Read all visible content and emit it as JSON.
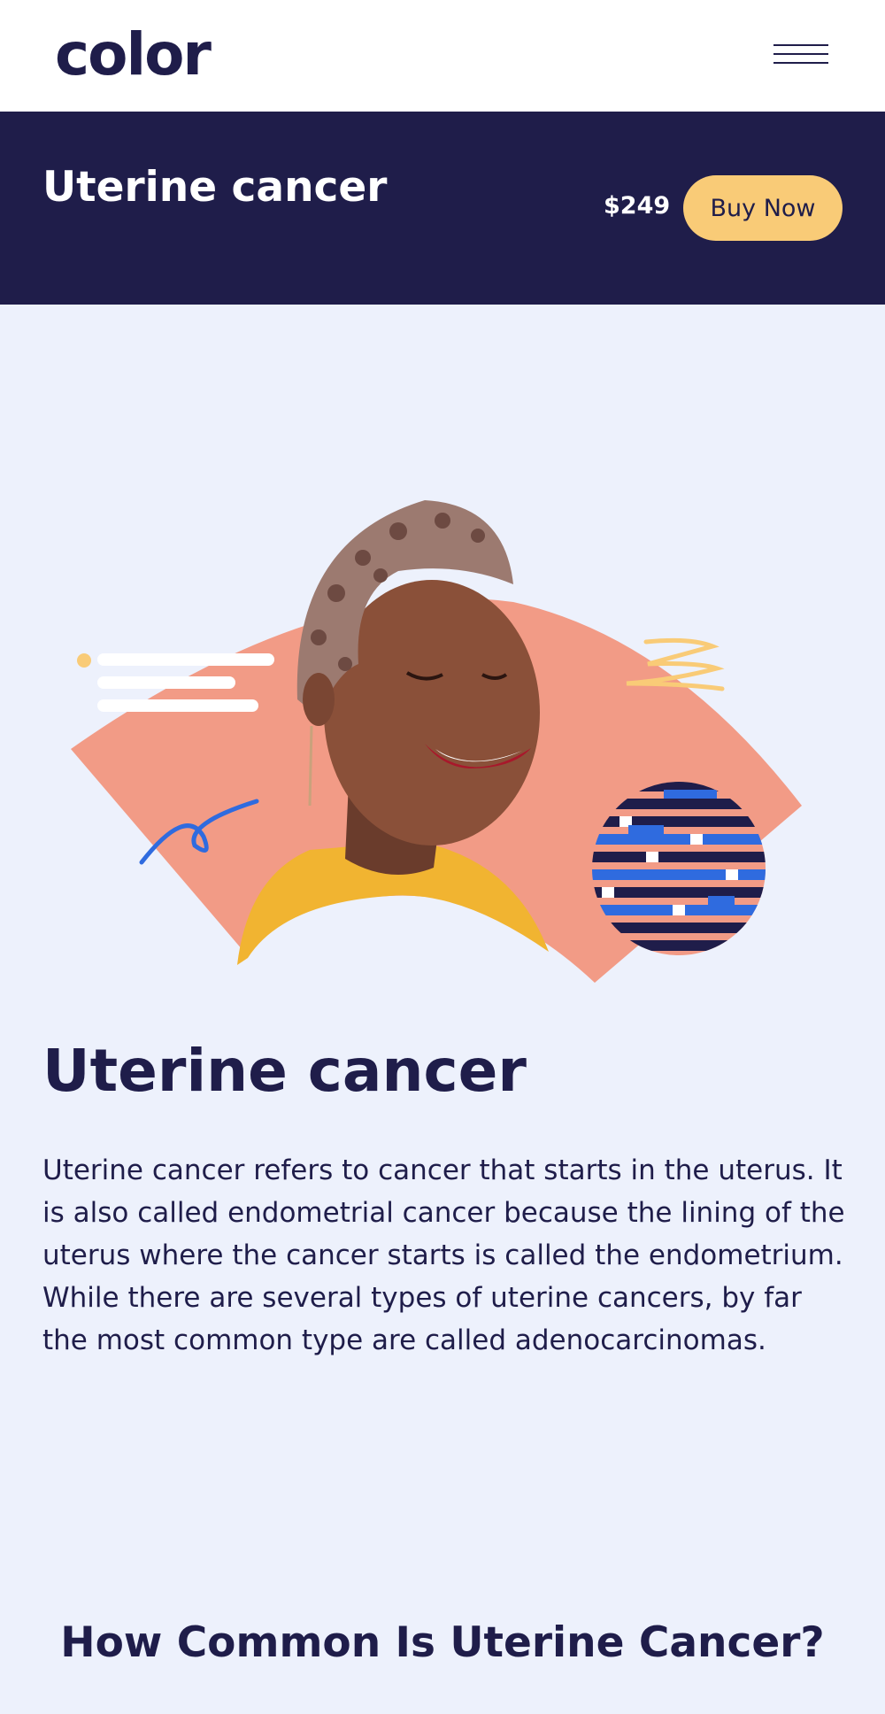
{
  "brand": {
    "logo_text": "color"
  },
  "header": {
    "menu_icon": "hamburger-menu-icon"
  },
  "hero_bar": {
    "title": "Uterine cancer",
    "price": "$249",
    "buy_button_label": "Buy Now"
  },
  "hero_illustration": {
    "subject": "smiling-woman-photo",
    "colors": {
      "fan": "#f29b86",
      "navy": "#1f1d4a",
      "blue": "#2f6bdf",
      "yellow": "#f9cb77",
      "background": "#edf1fc"
    }
  },
  "main": {
    "title": "Uterine cancer",
    "description": "Uterine cancer refers to cancer that starts in the uterus. It is also called endometrial cancer because the lining of the uterus where the cancer starts is called the endometrium. While there are several types of uterine cancers, by far the most common type are called adenocarcinomas.",
    "next_section_title": "How Common Is Uterine Cancer?"
  },
  "colors": {
    "navy": "#1f1d4a",
    "accent_yellow": "#f9cb77",
    "page_background": "#edf1fc"
  }
}
